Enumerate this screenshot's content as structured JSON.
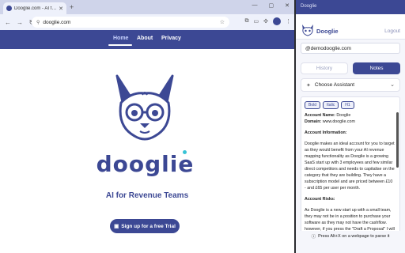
{
  "browser": {
    "tab_title": "Dooglie.com - AI for Revenue T…",
    "url": "dooglie.com"
  },
  "site": {
    "nav": {
      "home": "Home",
      "about": "About",
      "privacy": "Privacy"
    },
    "wordmark": "dooglie",
    "tagline": "AI for Revenue Teams",
    "signup_label": "Sign up for a free Trial"
  },
  "panel": {
    "window_title": "Dooglie",
    "brand": "Dooglie",
    "logout": "Logout",
    "domain": "@demodooglie.com",
    "tabs": {
      "history": "History",
      "notes": "Notes"
    },
    "assistant_label": "Choose Assistant",
    "format": {
      "bold": "Bold",
      "italic": "Italic",
      "h1": "H1"
    },
    "notes": {
      "account_name_label": "Account Name:",
      "account_name": "Dooglie",
      "domain_label": "Domain:",
      "domain": "www.dooglie.com",
      "info_heading": "Account Information:",
      "info_text": "Dooglie makes an ideal account for you to target as they would benefit from your AI revenue mapping functionality as Dooglie is a growing SaaS start up with 3 employees and few similar direct competitors and needs to capitalise on the category that they are building. They have a subscription model and are priced between £10 - and £65 per user per month.",
      "risks_heading": "Account Risks:",
      "risks_text": "As Dooglie is a new start up with a small team, they may not be in a position to purchase your software as they may not have the cashflow. however, if you press the \"Draft a Proposal\" I will design a commercial proposal that will maximise revenue while making the price suitable for this account."
    },
    "hint": "Press Alt+X on a webpage to parse it"
  }
}
